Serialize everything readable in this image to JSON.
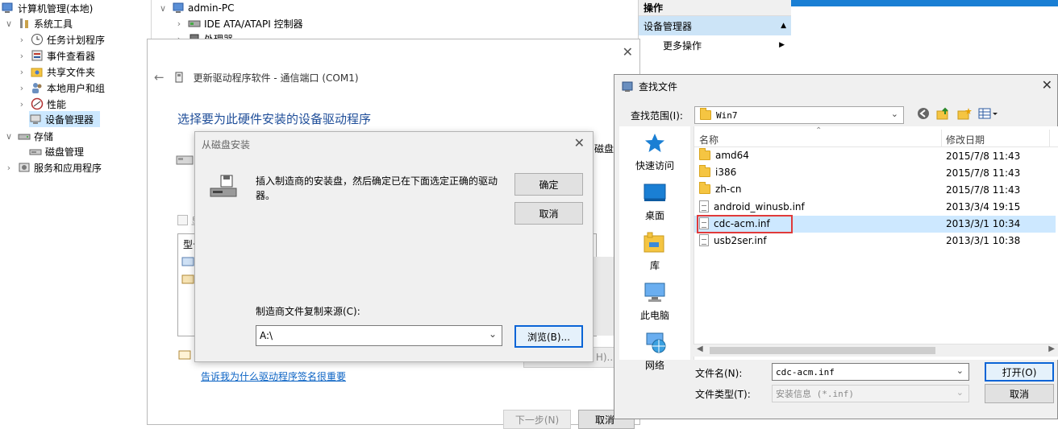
{
  "tree": {
    "root": "计算机管理(本地)",
    "system_tools": "系统工具",
    "task_scheduler": "任务计划程序",
    "event_viewer": "事件查看器",
    "shared_folders": "共享文件夹",
    "local_users": "本地用户和组",
    "performance": "性能",
    "device_manager": "设备管理器",
    "storage": "存储",
    "disk_management": "磁盘管理",
    "services_apps": "服务和应用程序"
  },
  "device_tree": {
    "computer": "admin-PC",
    "ide": "IDE ATA/ATAPI 控制器",
    "processor": "处理器"
  },
  "actions": {
    "header": "操作",
    "selected": "设备管理器",
    "more": "更多操作"
  },
  "wizard": {
    "title": "更新驱动程序软件 - 通信端口 (COM1)",
    "heading": "选择要为此硬件安装的设备驱动程序",
    "partial_disk": "磁盘",
    "partial_h": "H)...",
    "partial_model": "型号",
    "partial_show": "显",
    "link": "告诉我为什么驱动程序签名很重要",
    "next": "下一步(N)",
    "cancel": "取消"
  },
  "disk_dialog": {
    "title": "从磁盘安装",
    "message": "插入制造商的安装盘，然后确定已在下面选定正确的驱动器。",
    "ok": "确定",
    "cancel": "取消",
    "copy_from_label": "制造商文件复制来源(C):",
    "copy_from_value": "A:\\",
    "browse": "浏览(B)..."
  },
  "find_dialog": {
    "title": "查找文件",
    "look_in_label": "查找范围(I):",
    "look_in_value": "Win7",
    "places": [
      "快速访问",
      "桌面",
      "库",
      "此电脑",
      "网络"
    ],
    "col_name": "名称",
    "col_date": "修改日期",
    "files": [
      {
        "name": "amd64",
        "date": "2015/7/8 11:43",
        "type": "folder"
      },
      {
        "name": "i386",
        "date": "2015/7/8 11:43",
        "type": "folder"
      },
      {
        "name": "zh-cn",
        "date": "2015/7/8 11:43",
        "type": "folder"
      },
      {
        "name": "android_winusb.inf",
        "date": "2013/3/4 19:15",
        "type": "file"
      },
      {
        "name": "cdc-acm.inf",
        "date": "2013/3/1 10:34",
        "type": "file"
      },
      {
        "name": "usb2ser.inf",
        "date": "2013/3/1 10:38",
        "type": "file"
      }
    ],
    "filename_label": "文件名(N):",
    "filename_value": "cdc-acm.inf",
    "filetype_label": "文件类型(T):",
    "filetype_value": "安装信息 (*.inf)",
    "open": "打开(O)",
    "cancel": "取消"
  },
  "colors": {
    "selection": "#cde8ff",
    "accent": "#0a64d6",
    "highlight_box": "#e03a3a",
    "link": "#0b63c4",
    "heading": "#1f4e99"
  }
}
